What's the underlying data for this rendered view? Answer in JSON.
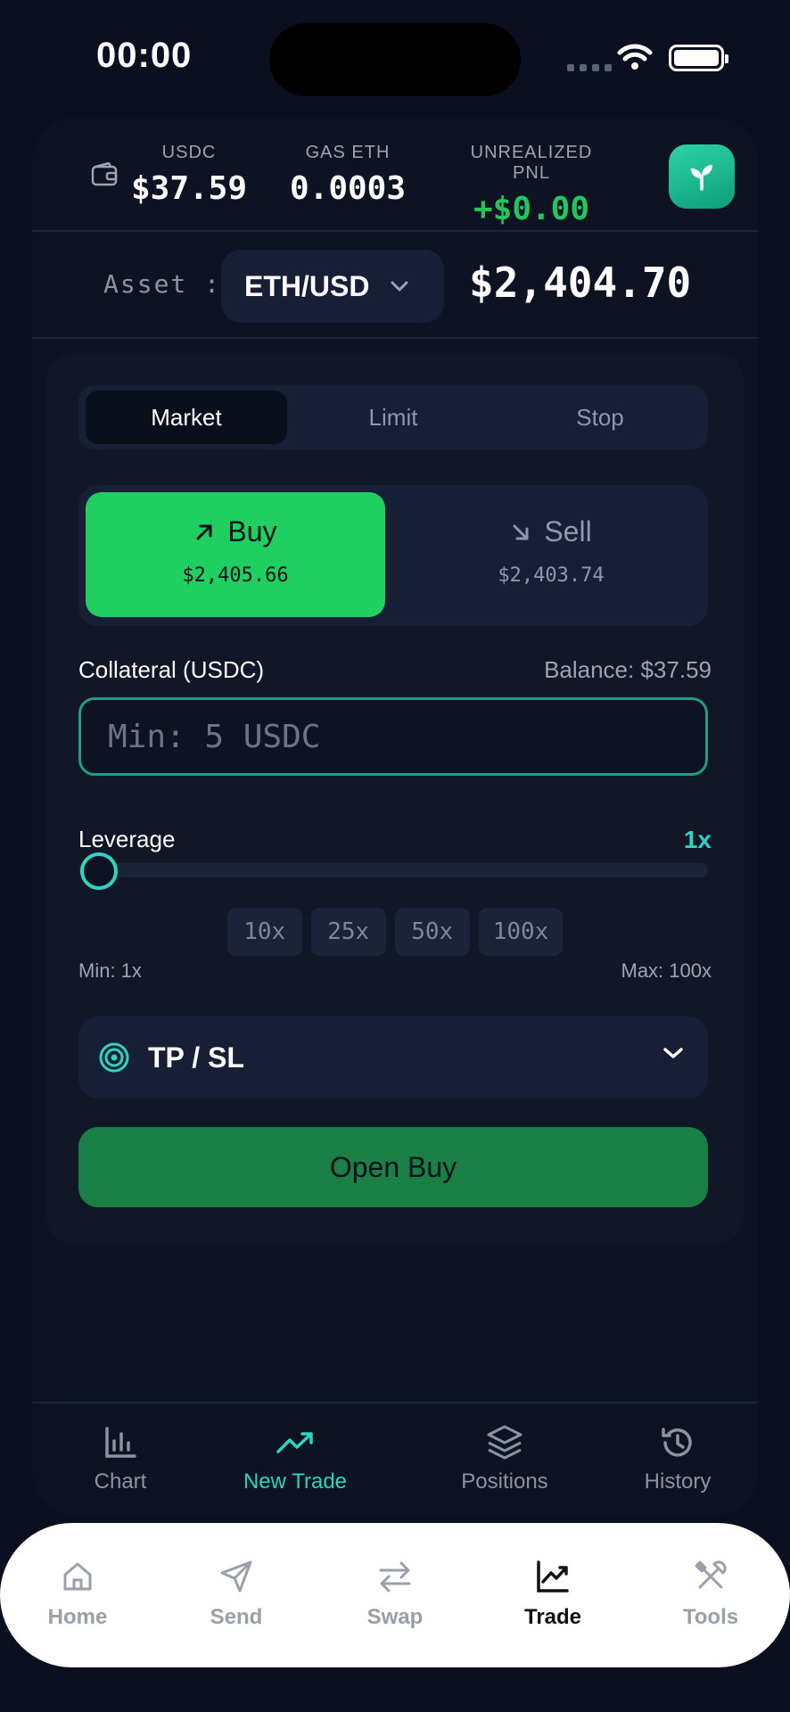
{
  "status": {
    "time": "00:00"
  },
  "stats": {
    "usdc_label": "USDC",
    "usdc_value": "$37.59",
    "gas_label": "GAS ETH",
    "gas_value": "0.0003",
    "pnl_label": "UNREALIZED PNL",
    "pnl_value": "+$0.00"
  },
  "asset": {
    "label": "Asset :",
    "pair": "ETH/USD",
    "price": "$2,404.70"
  },
  "order_types": [
    "Market",
    "Limit",
    "Stop"
  ],
  "sides": {
    "buy_label": "Buy",
    "buy_price": "$2,405.66",
    "sell_label": "Sell",
    "sell_price": "$2,403.74"
  },
  "collateral": {
    "label": "Collateral (USDC)",
    "balance": "Balance: $37.59",
    "placeholder": "Min: 5 USDC"
  },
  "leverage": {
    "label": "Leverage",
    "value": "1x",
    "chips": [
      "10x",
      "25x",
      "50x",
      "100x"
    ],
    "min": "Min: 1x",
    "max": "Max: 100x"
  },
  "tpsl": {
    "label": "TP / SL"
  },
  "open_button": "Open Buy",
  "inner_tabs": [
    "Chart",
    "New Trade",
    "Positions",
    "History"
  ],
  "outer_tabs": [
    "Home",
    "Send",
    "Swap",
    "Trade",
    "Tools"
  ],
  "colors": {
    "accent": "#2dd4bf",
    "buy": "#1fcf5f",
    "pnl": "#22c55e",
    "background": "#0b1020"
  }
}
